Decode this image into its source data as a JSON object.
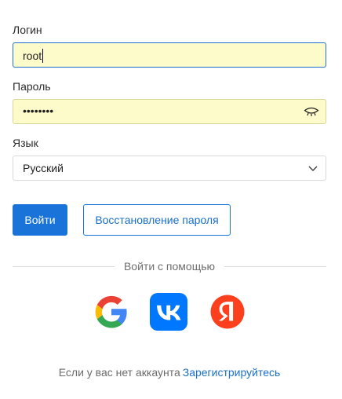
{
  "login": {
    "label": "Логин",
    "value": "root"
  },
  "password": {
    "label": "Пароль",
    "value": "••••••••",
    "toggle_icon": "eye-closed-icon"
  },
  "language": {
    "label": "Язык",
    "selected": "Русский",
    "icon": "chevron-down-icon"
  },
  "actions": {
    "login_button": "Войти",
    "restore_button": "Восстановление пароля"
  },
  "social": {
    "divider_text": "Войти с помощью",
    "providers": [
      {
        "name": "Google",
        "icon": "google-icon",
        "color": "#4285f4"
      },
      {
        "name": "VK",
        "icon": "vk-icon",
        "color": "#0077ff"
      },
      {
        "name": "Yandex",
        "icon": "yandex-icon",
        "color": "#fc3f1d"
      }
    ]
  },
  "footer": {
    "text": "Если у вас нет аккаунта",
    "link": "Зарегистрируйтесь"
  },
  "colors": {
    "primary": "#1a73d9",
    "autofill": "#fdfbc9"
  }
}
